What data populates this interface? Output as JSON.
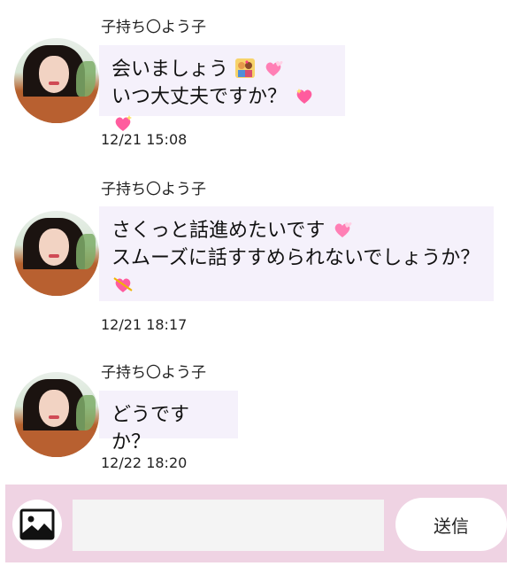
{
  "messages": [
    {
      "sender": "子持ち〇よう子",
      "lines": [
        "会いましょう",
        "いつ大丈夫ですか？"
      ],
      "time": "12/21 15:08"
    },
    {
      "sender": "子持ち〇よう子",
      "lines": [
        "さくっと話進めたいです",
        "スムーズに話すすめられないでしょうか？"
      ],
      "time": "12/21 18:17"
    },
    {
      "sender": "子持ち〇よう子",
      "lines": [
        "どうですか？"
      ],
      "time": "12/22 18:20"
    }
  ],
  "input": {
    "placeholder": "",
    "value": ""
  },
  "send_label": "送信",
  "icons": {
    "image_button": "image-icon"
  },
  "colors": {
    "bubble": "#f5f1fb",
    "input_bar": "#efd3e3",
    "heart_pink": "#ff5c9e"
  }
}
